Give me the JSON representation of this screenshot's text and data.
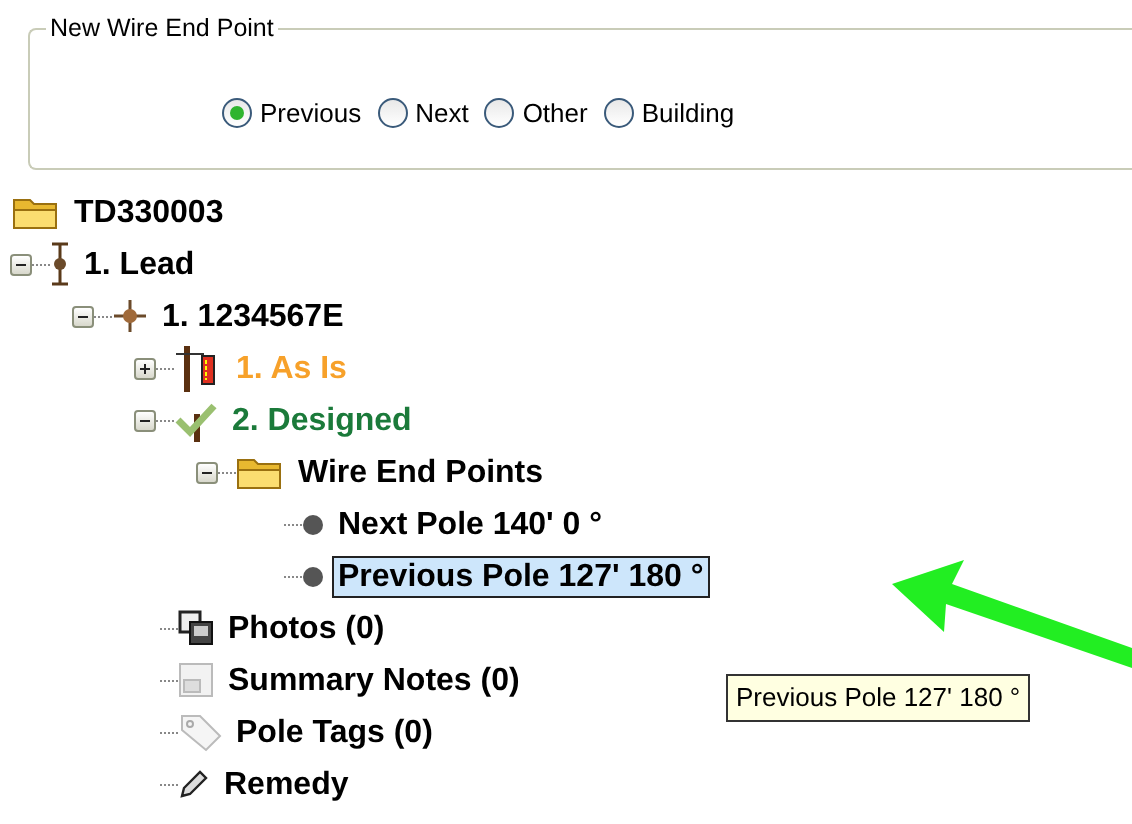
{
  "group_box": {
    "title": "New Wire End Point",
    "options": [
      {
        "label": "Previous",
        "selected": true
      },
      {
        "label": "Next",
        "selected": false
      },
      {
        "label": "Other",
        "selected": false
      },
      {
        "label": "Building",
        "selected": false
      }
    ]
  },
  "tree": [
    {
      "label": "TD330003",
      "kind": "folder",
      "children": [
        {
          "label": "1. Lead",
          "kind": "lead",
          "expanded": true,
          "children": [
            {
              "label": "1. 1234567E",
              "kind": "crosshair",
              "expanded": true,
              "children": [
                {
                  "label": "1. As Is",
                  "kind": "pole",
                  "expanded": false,
                  "color": "#f7a12a"
                },
                {
                  "label": "2. Designed",
                  "kind": "check",
                  "expanded": true,
                  "color": "#1b7a3a",
                  "children": [
                    {
                      "label": "Wire End Points",
                      "kind": "folder",
                      "expanded": true,
                      "children": [
                        {
                          "label": "Next Pole 140' 0 °",
                          "kind": "dot",
                          "selected": false
                        },
                        {
                          "label": "Previous Pole 127' 180 °",
                          "kind": "dot",
                          "selected": true
                        }
                      ]
                    }
                  ]
                },
                {
                  "label": "Photos (0)",
                  "kind": "photos"
                },
                {
                  "label": "Summary Notes (0)",
                  "kind": "notes"
                },
                {
                  "label": "Pole Tags (0)",
                  "kind": "tag"
                },
                {
                  "label": "Remedy",
                  "kind": "pencil"
                }
              ]
            }
          ]
        }
      ]
    }
  ],
  "tooltip": {
    "text": "Previous Pole 127' 180 °"
  }
}
